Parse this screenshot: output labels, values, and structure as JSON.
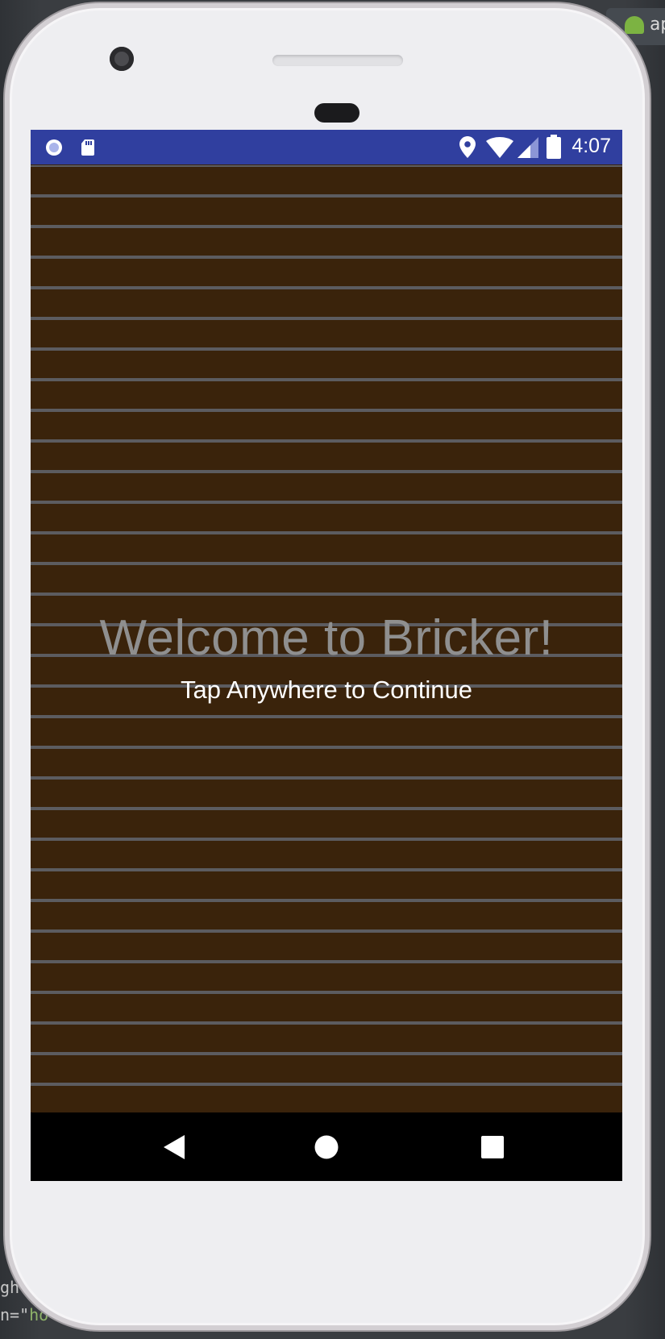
{
  "ide": {
    "tab_text": "ap",
    "code_line_1": "gh",
    "code_line_2_prefix": "n=\"",
    "code_line_2_string": "ho"
  },
  "status_bar": {
    "time": "4:07",
    "left_icons": [
      "circle-record-icon",
      "sd-card-icon"
    ],
    "right_icons": [
      "location-icon",
      "wifi-icon",
      "cell-signal-icon",
      "battery-icon"
    ],
    "color": "#303f9f"
  },
  "game": {
    "title": "Welcome to Bricker!",
    "subtitle": "Tap Anywhere to Continue",
    "brick_color": "#3a230b",
    "mortar_color": "#5a5a5f"
  },
  "nav_bar": {
    "buttons": [
      "back-icon",
      "home-icon",
      "recents-icon"
    ]
  }
}
